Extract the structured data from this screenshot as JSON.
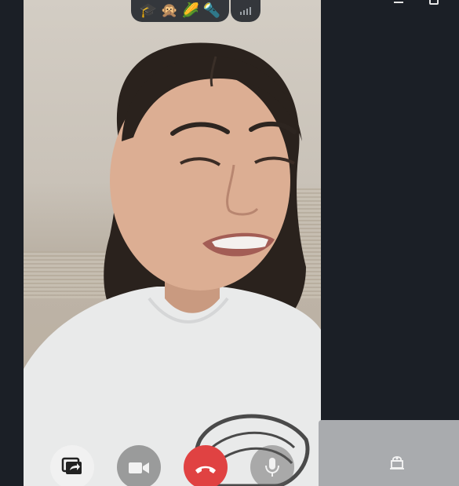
{
  "window": {
    "minimize_icon": "minimize-icon",
    "maximize_icon": "maximize-icon"
  },
  "call": {
    "emoji_key": [
      "🎓",
      "🙊",
      "🌽",
      "🔦"
    ],
    "signal_icon": "signal-bars-icon"
  },
  "controls": [
    {
      "name": "screen-share-button",
      "icon": "screen-share-icon"
    },
    {
      "name": "camera-toggle-button",
      "icon": "video-camera-icon"
    },
    {
      "name": "hang-up-button",
      "icon": "phone-hangup-icon"
    },
    {
      "name": "microphone-toggle-button",
      "icon": "microphone-icon"
    }
  ],
  "self_preview": {
    "icon": "camera-off-icon"
  },
  "colors": {
    "background": "#1b1f26",
    "hangup": "#e04242",
    "share_button": "#f1f1f1",
    "self_tile": "#a9abae"
  }
}
